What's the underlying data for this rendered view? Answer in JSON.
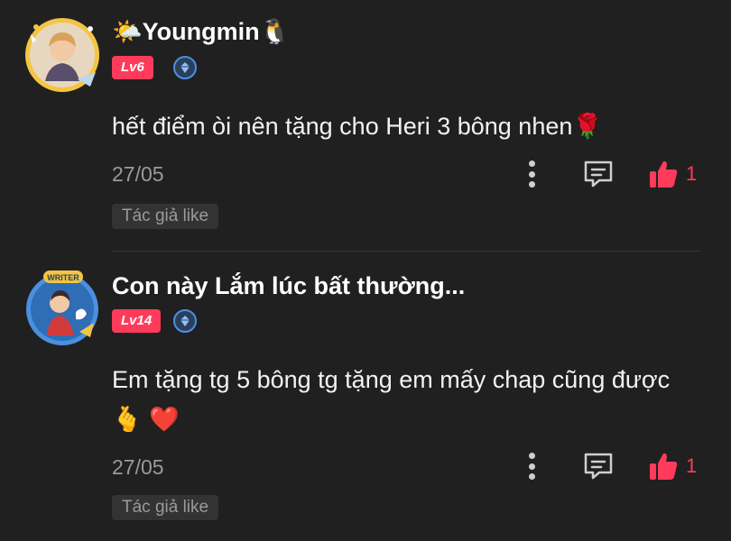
{
  "comments": [
    {
      "username": "🌤️Youngmin🐧",
      "level": "Lv6",
      "text": "hết điểm òi nên tặng cho Heri 3 bông nhen🌹",
      "date": "27/05",
      "likes": "1",
      "author_like": "Tác giả like"
    },
    {
      "username": "Con này Lắm lúc bất thường...",
      "level": "Lv14",
      "badge_text": "WRITER",
      "text": "Em tặng tg 5 bông tg tặng em mấy chap cũng được🫰 ❤️",
      "date": "27/05",
      "likes": "1",
      "author_like": "Tác giả like"
    }
  ],
  "icons": {
    "more": "more-vertical-icon",
    "reply": "comment-reply-icon",
    "like": "thumbs-up-icon",
    "rank": "diamond-rank-icon"
  },
  "colors": {
    "background": "#202020",
    "accent": "#ff3b5c",
    "muted": "#9a9a9a",
    "rank_blue": "#4a90e2"
  }
}
